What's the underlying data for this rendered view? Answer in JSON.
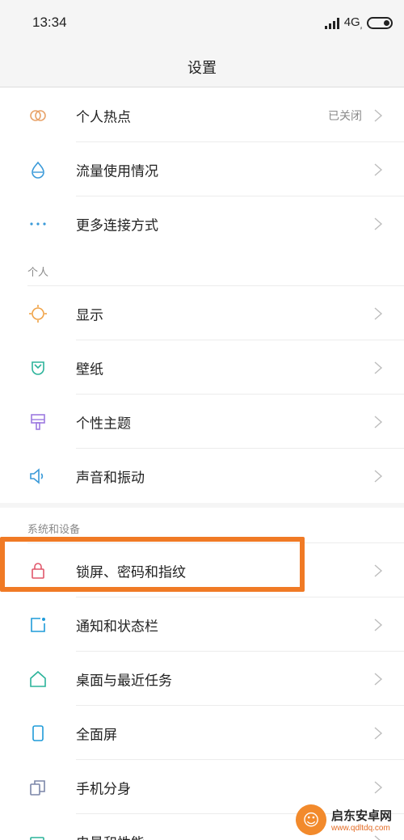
{
  "status_bar": {
    "time": "13:34",
    "network": "4G",
    "network_sub": "ᵢₗ"
  },
  "header": {
    "title": "设置"
  },
  "group1": [
    {
      "label": "个人热点",
      "value": "已关闭",
      "icon": "hotspot-icon",
      "color": "#e8a36a"
    },
    {
      "label": "流量使用情况",
      "icon": "data-usage-icon",
      "color": "#3a9ad9"
    },
    {
      "label": "更多连接方式",
      "icon": "more-dots-icon",
      "color": "#3a9ad9"
    }
  ],
  "section_personal": {
    "title": "个人"
  },
  "group2": [
    {
      "label": "显示",
      "icon": "display-sun-icon",
      "color": "#f0a348"
    },
    {
      "label": "壁纸",
      "icon": "wallpaper-icon",
      "color": "#2bb39a"
    },
    {
      "label": "个性主题",
      "icon": "theme-brush-icon",
      "color": "#9c7ae0"
    },
    {
      "label": "声音和振动",
      "icon": "speaker-icon",
      "color": "#3a9ad9"
    }
  ],
  "section_system": {
    "title": "系统和设备"
  },
  "group3": [
    {
      "label": "锁屏、密码和指纹",
      "icon": "lock-icon",
      "color": "#e0566a"
    },
    {
      "label": "通知和状态栏",
      "icon": "notification-icon",
      "color": "#1f9bd9"
    },
    {
      "label": "桌面与最近任务",
      "icon": "home-icon",
      "color": "#2bb39a"
    },
    {
      "label": "全面屏",
      "icon": "fullscreen-phone-icon",
      "color": "#1f9bd9"
    },
    {
      "label": "手机分身",
      "icon": "second-space-icon",
      "color": "#7b86a8"
    },
    {
      "label": "电量和性能",
      "icon": "battery-performance-icon",
      "color": "#2bb39a"
    }
  ],
  "watermark": {
    "name": "启东安卓网",
    "url": "www.qdltdq.com"
  }
}
